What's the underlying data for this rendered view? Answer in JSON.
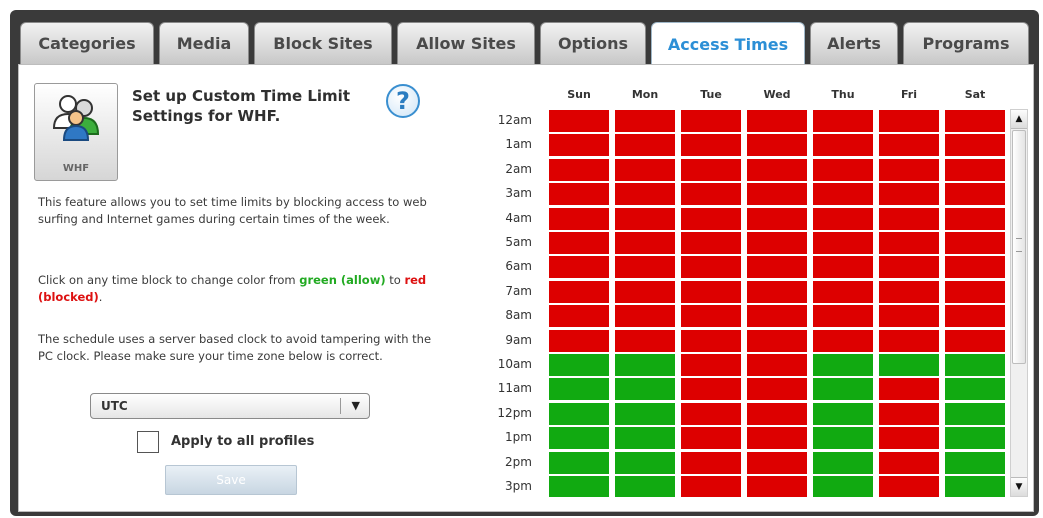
{
  "tabs": [
    {
      "label": "Categories",
      "active": false
    },
    {
      "label": "Media",
      "active": false
    },
    {
      "label": "Block Sites",
      "active": false
    },
    {
      "label": "Allow Sites",
      "active": false
    },
    {
      "label": "Options",
      "active": false
    },
    {
      "label": "Access Times",
      "active": true
    },
    {
      "label": "Alerts",
      "active": false
    },
    {
      "label": "Programs",
      "active": false
    }
  ],
  "profile": {
    "name": "WHF"
  },
  "header": {
    "title": "Set up Custom Time Limit Settings for WHF.",
    "help_label": "?"
  },
  "description": {
    "p1": "This feature allows you to set time limits by blocking access to web surfing and Internet games during certain times of the week.",
    "p2_prefix": "Click on any time block to change color from",
    "p2_green": "green (allow)",
    "p2_mid": "to",
    "p2_red": "red (blocked)",
    "p2_end": ".",
    "p3": "The schedule uses a server based clock to avoid tampering with the PC clock.  Please make sure your time zone below is correct."
  },
  "timezone": {
    "selected": "UTC",
    "arrow": "▼"
  },
  "apply_all": {
    "label": "Apply to all profiles",
    "checked": false
  },
  "save": {
    "label": "Save"
  },
  "schedule": {
    "days": [
      "Sun",
      "Mon",
      "Tue",
      "Wed",
      "Thu",
      "Fri",
      "Sat"
    ],
    "hours": [
      "12am",
      "1am",
      "2am",
      "3am",
      "4am",
      "5am",
      "6am",
      "7am",
      "8am",
      "9am",
      "10am",
      "11am",
      "12pm",
      "1pm",
      "2pm",
      "3pm"
    ],
    "colors": {
      "blocked": "#dd0000",
      "allowed": "#11aa11"
    },
    "states": [
      [
        "B",
        "B",
        "B",
        "B",
        "B",
        "B",
        "B"
      ],
      [
        "B",
        "B",
        "B",
        "B",
        "B",
        "B",
        "B"
      ],
      [
        "B",
        "B",
        "B",
        "B",
        "B",
        "B",
        "B"
      ],
      [
        "B",
        "B",
        "B",
        "B",
        "B",
        "B",
        "B"
      ],
      [
        "B",
        "B",
        "B",
        "B",
        "B",
        "B",
        "B"
      ],
      [
        "B",
        "B",
        "B",
        "B",
        "B",
        "B",
        "B"
      ],
      [
        "B",
        "B",
        "B",
        "B",
        "B",
        "B",
        "B"
      ],
      [
        "B",
        "B",
        "B",
        "B",
        "B",
        "B",
        "B"
      ],
      [
        "B",
        "B",
        "B",
        "B",
        "B",
        "B",
        "B"
      ],
      [
        "B",
        "B",
        "B",
        "B",
        "B",
        "B",
        "B"
      ],
      [
        "A",
        "A",
        "B",
        "B",
        "A",
        "A",
        "A"
      ],
      [
        "A",
        "A",
        "B",
        "B",
        "A",
        "B",
        "A"
      ],
      [
        "A",
        "A",
        "B",
        "B",
        "A",
        "B",
        "A"
      ],
      [
        "A",
        "A",
        "B",
        "B",
        "A",
        "B",
        "A"
      ],
      [
        "A",
        "A",
        "B",
        "B",
        "A",
        "B",
        "A"
      ],
      [
        "A",
        "A",
        "B",
        "B",
        "A",
        "B",
        "A"
      ]
    ]
  },
  "scrollbar": {
    "up": "▲",
    "down": "▼"
  }
}
